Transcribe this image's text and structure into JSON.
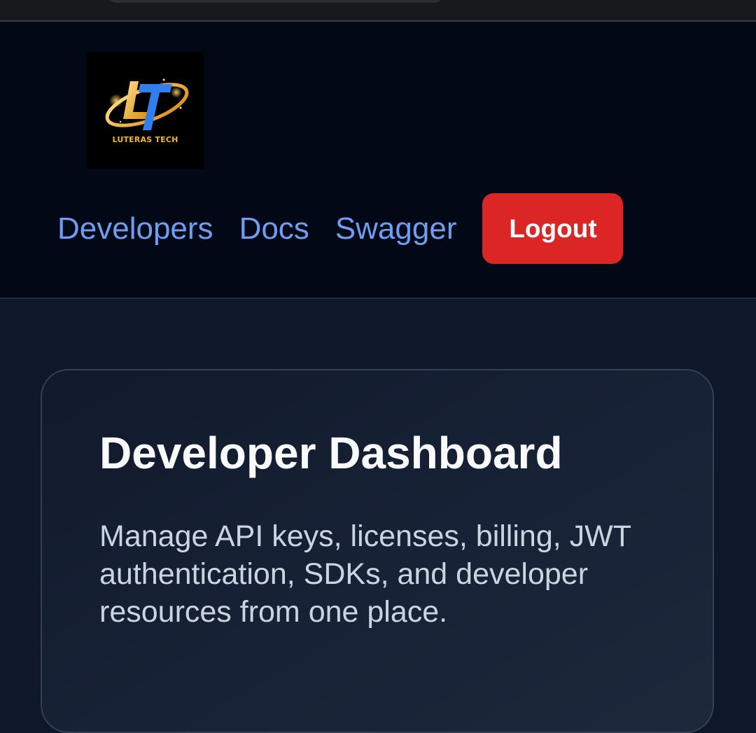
{
  "logo": {
    "text": "LUTERAS TECH",
    "monogram": "LT",
    "colors": {
      "gold": "#f4b629",
      "blue": "#2f80ed"
    }
  },
  "nav": {
    "links": [
      "Developers",
      "Docs",
      "Swagger"
    ],
    "logout_label": "Logout"
  },
  "hero": {
    "title": "Developer Dashboard",
    "description": "Manage API keys, licenses, billing, JWT authentication, SDKs, and developer resources from one place."
  },
  "colors": {
    "header_bg": "#030816",
    "page_bg": "#0f172a",
    "link": "#6e9ef0",
    "logout": "#dc2626"
  }
}
